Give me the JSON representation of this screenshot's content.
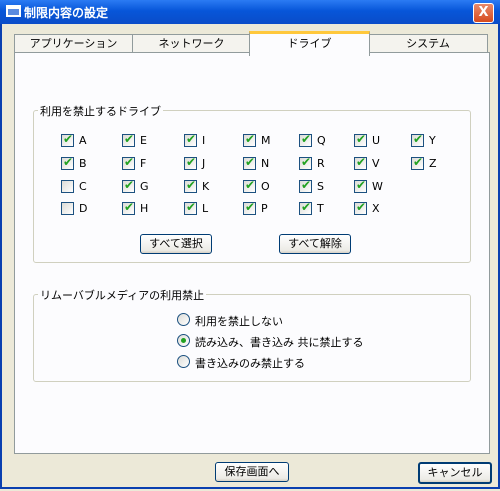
{
  "window": {
    "title": "制限内容の設定",
    "close_glyph": "X"
  },
  "tabs": [
    {
      "label": "アプリケーション",
      "active": false
    },
    {
      "label": "ネットワーク",
      "active": false
    },
    {
      "label": "ドライブ",
      "active": true
    },
    {
      "label": "システム",
      "active": false
    }
  ],
  "drive_group": {
    "label": "利用を禁止するドライブ",
    "drives": [
      {
        "letter": "A",
        "checked": true
      },
      {
        "letter": "B",
        "checked": true
      },
      {
        "letter": "C",
        "checked": false
      },
      {
        "letter": "D",
        "checked": false
      },
      {
        "letter": "E",
        "checked": true
      },
      {
        "letter": "F",
        "checked": true
      },
      {
        "letter": "G",
        "checked": true
      },
      {
        "letter": "H",
        "checked": true
      },
      {
        "letter": "I",
        "checked": true
      },
      {
        "letter": "J",
        "checked": true
      },
      {
        "letter": "K",
        "checked": true
      },
      {
        "letter": "L",
        "checked": true
      },
      {
        "letter": "M",
        "checked": true
      },
      {
        "letter": "N",
        "checked": true
      },
      {
        "letter": "O",
        "checked": true
      },
      {
        "letter": "P",
        "checked": true
      },
      {
        "letter": "Q",
        "checked": true
      },
      {
        "letter": "R",
        "checked": true
      },
      {
        "letter": "S",
        "checked": true
      },
      {
        "letter": "T",
        "checked": true
      },
      {
        "letter": "U",
        "checked": true
      },
      {
        "letter": "V",
        "checked": true
      },
      {
        "letter": "W",
        "checked": true
      },
      {
        "letter": "X",
        "checked": true
      },
      {
        "letter": "Y",
        "checked": true
      },
      {
        "letter": "Z",
        "checked": true
      }
    ],
    "select_all_label": "すべて選択",
    "deselect_all_label": "すべて解除"
  },
  "media_group": {
    "label": "リムーバブルメディアの利用禁止",
    "options": [
      {
        "label": "利用を禁止しない",
        "selected": false
      },
      {
        "label": "読み込み、書き込み 共に禁止する",
        "selected": true
      },
      {
        "label": "書き込みのみ禁止する",
        "selected": false
      }
    ]
  },
  "footer": {
    "save_label": "保存画面へ",
    "cancel_label": "キャンセル"
  },
  "colors": {
    "check": "#21A121",
    "titlebar": "#0A4CC8",
    "tab_accent": "#FFC83C"
  }
}
